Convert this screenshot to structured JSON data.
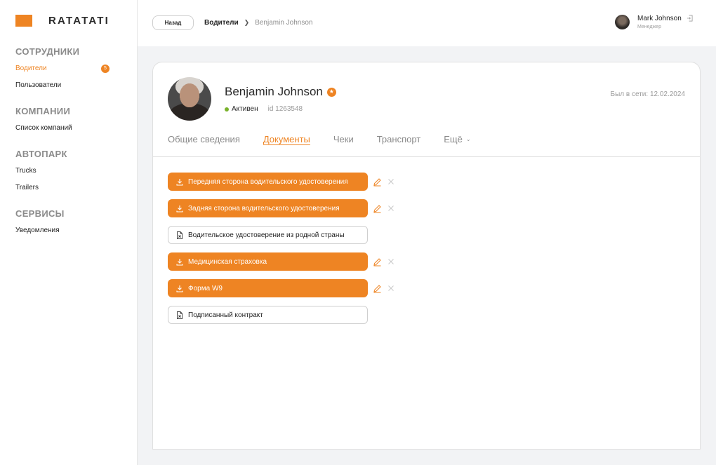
{
  "brand": {
    "name": "RATATATI",
    "color": "#ee8423"
  },
  "sidebar": {
    "sections": [
      {
        "heading": "СОТРУДНИКИ",
        "items": [
          {
            "label": "Водители",
            "active": true,
            "badge": "5"
          },
          {
            "label": "Пользователи"
          }
        ]
      },
      {
        "heading": "КОМПАНИИ",
        "items": [
          {
            "label": "Список компаний"
          }
        ]
      },
      {
        "heading": "АВТОПАРК",
        "items": [
          {
            "label": "Trucks"
          },
          {
            "label": "Trailers"
          }
        ]
      },
      {
        "heading": "СЕРВИСЫ",
        "items": [
          {
            "label": "Уведомления"
          }
        ]
      }
    ]
  },
  "header": {
    "back_label": "Назад",
    "breadcrumb": {
      "parent": "Водители",
      "current": "Benjamin Johnson"
    },
    "user": {
      "name": "Mark Johnson",
      "role": "Менеджер"
    }
  },
  "profile": {
    "name": "Benjamin Johnson",
    "status": "Активен",
    "id": "id 1263548",
    "last_seen": "Был в сети: 12.02.2024"
  },
  "tabs": [
    {
      "label": "Общие сведения"
    },
    {
      "label": "Документы",
      "active": true
    },
    {
      "label": "Чеки"
    },
    {
      "label": "Транспорт"
    },
    {
      "label": "Ещё",
      "dropdown": true
    }
  ],
  "documents": [
    {
      "label": "Передняя сторона водительского удостоверения",
      "uploaded": true
    },
    {
      "label": "Задняя сторона водительского удостоверения",
      "uploaded": true
    },
    {
      "label": "Водительское удостоверение из родной страны",
      "uploaded": false
    },
    {
      "label": "Медицинская страховка",
      "uploaded": true
    },
    {
      "label": "Форма W9",
      "uploaded": true
    },
    {
      "label": "Подписанный контракт",
      "uploaded": false
    }
  ]
}
